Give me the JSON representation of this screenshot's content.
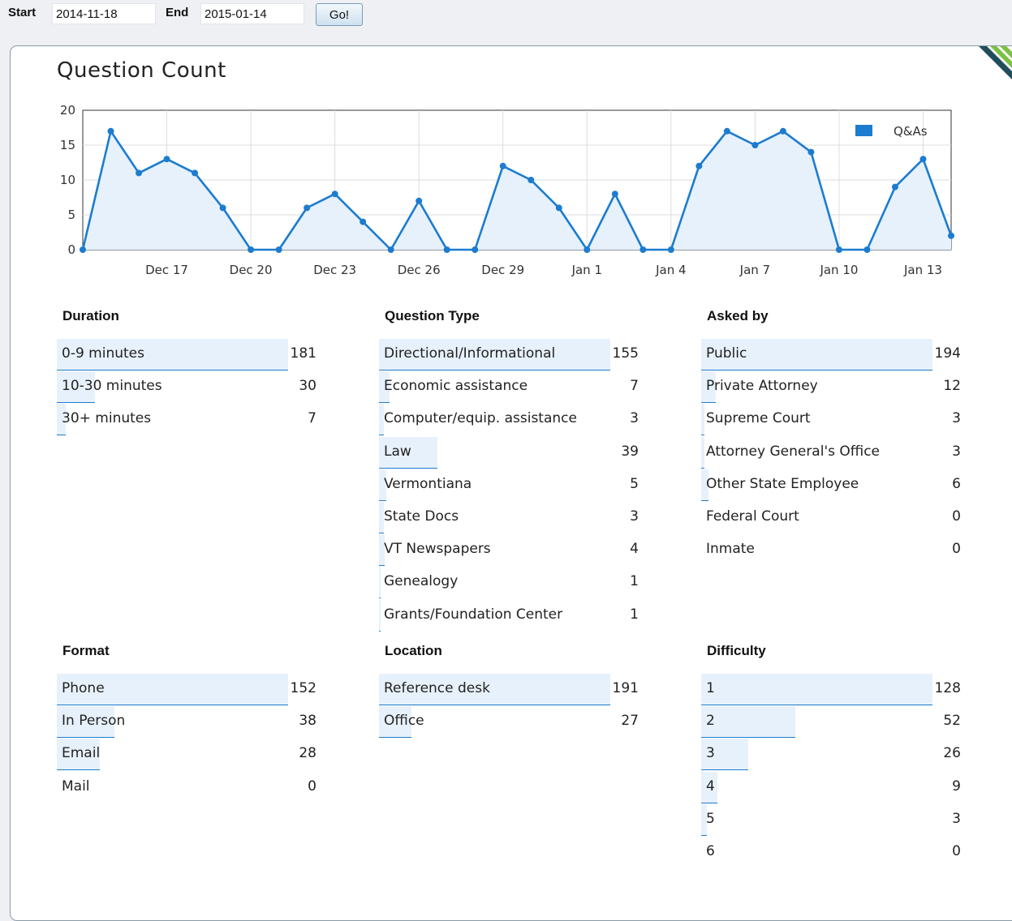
{
  "filters": {
    "start_label": "Start",
    "start_value": "2014-11-18",
    "end_label": "End",
    "end_value": "2015-01-14",
    "go_label": "Go!"
  },
  "page": {
    "title": "Question Count"
  },
  "colors": {
    "accent": "#1c7ccf",
    "bar_fill": "#e7f1fb",
    "area_fill": "#e6f1fb",
    "panel_border": "#8a9aa6"
  },
  "chart_data": {
    "type": "area",
    "title": "",
    "xlabel": "",
    "ylabel": "",
    "ylim": [
      0,
      20
    ],
    "yticks": [
      0,
      5,
      10,
      15,
      20
    ],
    "xlim": [
      "2014-12-14",
      "2015-01-14"
    ],
    "xticks": [
      "Dec 17",
      "Dec 20",
      "Dec 23",
      "Dec 26",
      "Dec 29",
      "Jan 1",
      "Jan 4",
      "Jan 7",
      "Jan 10",
      "Jan 13"
    ],
    "grid": true,
    "legend": "top-right",
    "series": [
      {
        "name": "Q&As",
        "x": [
          "2014-12-14",
          "2014-12-15",
          "2014-12-16",
          "2014-12-17",
          "2014-12-18",
          "2014-12-19",
          "2014-12-20",
          "2014-12-21",
          "2014-12-22",
          "2014-12-23",
          "2014-12-24",
          "2014-12-25",
          "2014-12-26",
          "2014-12-27",
          "2014-12-28",
          "2014-12-29",
          "2014-12-30",
          "2014-12-31",
          "2015-01-01",
          "2015-01-02",
          "2015-01-03",
          "2015-01-04",
          "2015-01-05",
          "2015-01-06",
          "2015-01-07",
          "2015-01-08",
          "2015-01-09",
          "2015-01-10",
          "2015-01-11",
          "2015-01-12",
          "2015-01-13",
          "2015-01-14"
        ],
        "values": [
          0,
          17,
          11,
          13,
          11,
          6,
          0,
          0,
          6,
          8,
          4,
          0,
          7,
          0,
          0,
          12,
          10,
          6,
          0,
          8,
          0,
          0,
          12,
          17,
          15,
          17,
          14,
          0,
          0,
          9,
          13,
          2
        ]
      }
    ]
  },
  "stats": [
    {
      "title": "Duration",
      "max": 181,
      "rows": [
        {
          "label": "0-9 minutes",
          "value": 181
        },
        {
          "label": "10-30 minutes",
          "value": 30
        },
        {
          "label": "30+ minutes",
          "value": 7
        }
      ]
    },
    {
      "title": "Question Type",
      "max": 155,
      "rows": [
        {
          "label": "Directional/Informational",
          "value": 155
        },
        {
          "label": "Economic assistance",
          "value": 7
        },
        {
          "label": "Computer/equip. assistance",
          "value": 3
        },
        {
          "label": "Law",
          "value": 39
        },
        {
          "label": "Vermontiana",
          "value": 5
        },
        {
          "label": "State Docs",
          "value": 3
        },
        {
          "label": "VT Newspapers",
          "value": 4
        },
        {
          "label": "Genealogy",
          "value": 1
        },
        {
          "label": "Grants/Foundation Center",
          "value": 1
        }
      ]
    },
    {
      "title": "Asked by",
      "max": 194,
      "rows": [
        {
          "label": "Public",
          "value": 194
        },
        {
          "label": "Private Attorney",
          "value": 12
        },
        {
          "label": "Supreme Court",
          "value": 3
        },
        {
          "label": "Attorney General's Office",
          "value": 3
        },
        {
          "label": "Other State Employee",
          "value": 6
        },
        {
          "label": "Federal Court",
          "value": 0
        },
        {
          "label": "Inmate",
          "value": 0
        }
      ]
    },
    {
      "title": "Format",
      "max": 152,
      "rows": [
        {
          "label": "Phone",
          "value": 152
        },
        {
          "label": "In Person",
          "value": 38
        },
        {
          "label": "Email",
          "value": 28
        },
        {
          "label": "Mail",
          "value": 0
        }
      ]
    },
    {
      "title": "Location",
      "max": 191,
      "rows": [
        {
          "label": "Reference desk",
          "value": 191
        },
        {
          "label": "Office",
          "value": 27
        }
      ]
    },
    {
      "title": "Difficulty",
      "max": 128,
      "rows": [
        {
          "label": "1",
          "value": 128
        },
        {
          "label": "2",
          "value": 52
        },
        {
          "label": "3",
          "value": 26
        },
        {
          "label": "4",
          "value": 9
        },
        {
          "label": "5",
          "value": 3
        },
        {
          "label": "6",
          "value": 0
        }
      ]
    }
  ]
}
